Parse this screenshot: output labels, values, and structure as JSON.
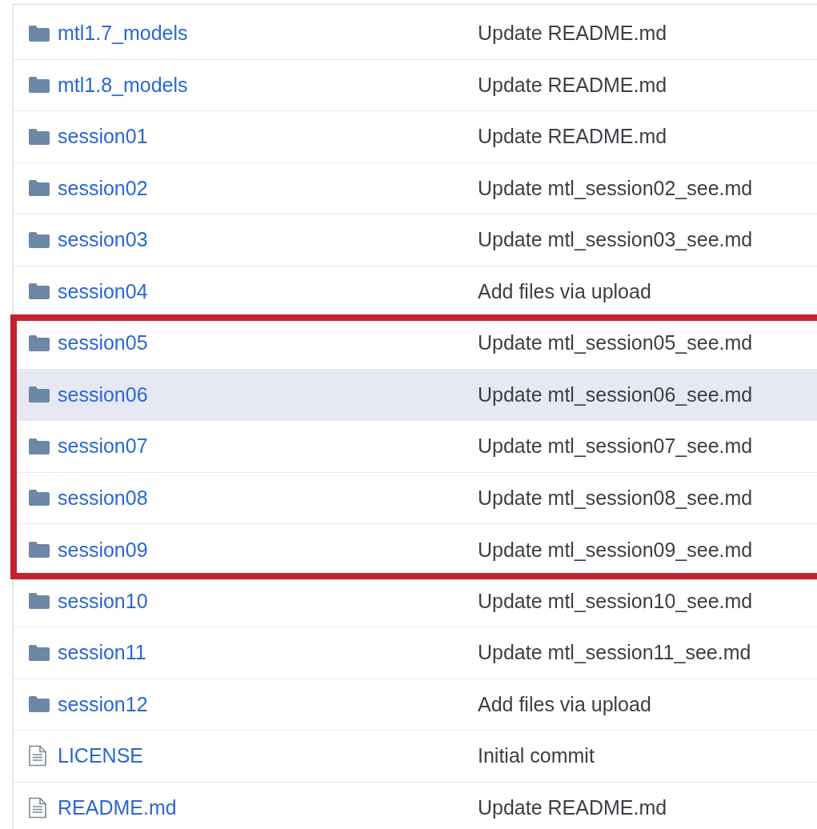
{
  "files": [
    {
      "kind": "folder",
      "name": "mtl1.7_models",
      "message": "Update README.md",
      "hovered": false,
      "boxed": false
    },
    {
      "kind": "folder",
      "name": "mtl1.8_models",
      "message": "Update README.md",
      "hovered": false,
      "boxed": false
    },
    {
      "kind": "folder",
      "name": "session01",
      "message": "Update README.md",
      "hovered": false,
      "boxed": false
    },
    {
      "kind": "folder",
      "name": "session02",
      "message": "Update mtl_session02_see.md",
      "hovered": false,
      "boxed": false
    },
    {
      "kind": "folder",
      "name": "session03",
      "message": "Update mtl_session03_see.md",
      "hovered": false,
      "boxed": false
    },
    {
      "kind": "folder",
      "name": "session04",
      "message": "Add files via upload",
      "hovered": false,
      "boxed": false
    },
    {
      "kind": "folder",
      "name": "session05",
      "message": "Update mtl_session05_see.md",
      "hovered": false,
      "boxed": true
    },
    {
      "kind": "folder",
      "name": "session06",
      "message": "Update mtl_session06_see.md",
      "hovered": true,
      "boxed": true
    },
    {
      "kind": "folder",
      "name": "session07",
      "message": "Update mtl_session07_see.md",
      "hovered": false,
      "boxed": true
    },
    {
      "kind": "folder",
      "name": "session08",
      "message": "Update mtl_session08_see.md",
      "hovered": false,
      "boxed": true
    },
    {
      "kind": "folder",
      "name": "session09",
      "message": "Update mtl_session09_see.md",
      "hovered": false,
      "boxed": true
    },
    {
      "kind": "folder",
      "name": "session10",
      "message": "Update mtl_session10_see.md",
      "hovered": false,
      "boxed": false
    },
    {
      "kind": "folder",
      "name": "session11",
      "message": "Update mtl_session11_see.md",
      "hovered": false,
      "boxed": false
    },
    {
      "kind": "folder",
      "name": "session12",
      "message": "Add files via upload",
      "hovered": false,
      "boxed": false
    },
    {
      "kind": "file",
      "name": "LICENSE",
      "message": "Initial commit",
      "hovered": false,
      "boxed": false
    },
    {
      "kind": "file",
      "name": "README.md",
      "message": "Update README.md",
      "hovered": false,
      "boxed": false
    }
  ]
}
